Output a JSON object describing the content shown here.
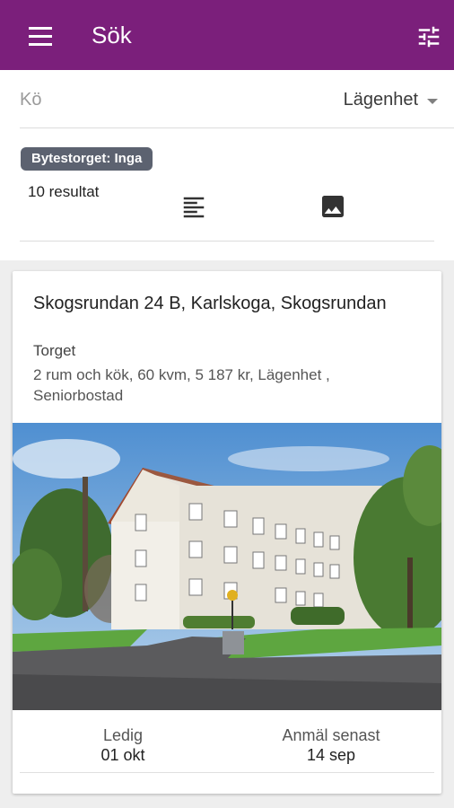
{
  "app_bar": {
    "title": "Sök",
    "background": "#7b1f7b",
    "menu_icon": "hamburger-menu-icon",
    "filter_icon": "tune-sliders-icon"
  },
  "filters": {
    "queue_placeholder": "Kö",
    "type_selected": "Lägenhet"
  },
  "chip": {
    "label": "Bytestorget: Inga"
  },
  "results": {
    "count_text": "10 resultat",
    "list_view_icon": "list-view-icon",
    "image_view_icon": "image-view-icon"
  },
  "listing": {
    "address": "Skogsrundan 24 B, Karlskoga, Skogsrundan",
    "area": "Torget",
    "description": "2 rum och kök, 60 kvm, 5 187 kr, Lägenhet , Seniorbostad",
    "available_label": "Ledig",
    "available_value": "01 okt",
    "deadline_label": "Anmäl senast",
    "deadline_value": "14 sep"
  }
}
